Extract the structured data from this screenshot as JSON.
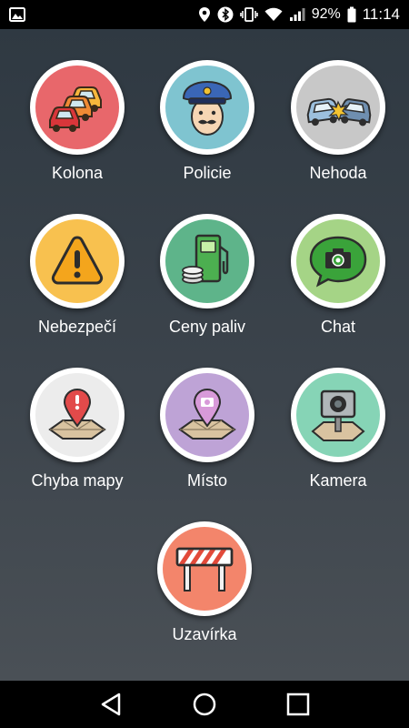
{
  "status_bar": {
    "battery_percent": "92%",
    "time": "11:14",
    "icons": [
      "image-notification-icon",
      "location-icon",
      "bluetooth-icon",
      "vibrate-icon",
      "wifi-icon",
      "signal-icon",
      "battery-icon"
    ]
  },
  "reports": [
    {
      "id": "kolona",
      "label": "Kolona",
      "icon": "traffic-jam-icon",
      "color": "#e8676b"
    },
    {
      "id": "policie",
      "label": "Policie",
      "icon": "police-icon",
      "color": "#7fc4d0"
    },
    {
      "id": "nehoda",
      "label": "Nehoda",
      "icon": "accident-icon",
      "color": "#c8c8c8"
    },
    {
      "id": "nebezpeci",
      "label": "Nebezpečí",
      "icon": "hazard-icon",
      "color": "#f8c14f"
    },
    {
      "id": "ceny-paliv",
      "label": "Ceny paliv",
      "icon": "fuel-price-icon",
      "color": "#5eb48a"
    },
    {
      "id": "chat",
      "label": "Chat",
      "icon": "chat-camera-icon",
      "color": "#a5d486"
    },
    {
      "id": "chyba-mapy",
      "label": "Chyba mapy",
      "icon": "map-error-icon",
      "color": "#ececec"
    },
    {
      "id": "misto",
      "label": "Místo",
      "icon": "place-icon",
      "color": "#bea3d6"
    },
    {
      "id": "kamera",
      "label": "Kamera",
      "icon": "speed-camera-icon",
      "color": "#86d4b6"
    },
    {
      "id": "uzavirka",
      "label": "Uzavírka",
      "icon": "road-closure-icon",
      "color": "#f3856b"
    }
  ],
  "nav_bar": {
    "buttons": [
      "back-icon",
      "home-icon",
      "recents-icon"
    ]
  }
}
